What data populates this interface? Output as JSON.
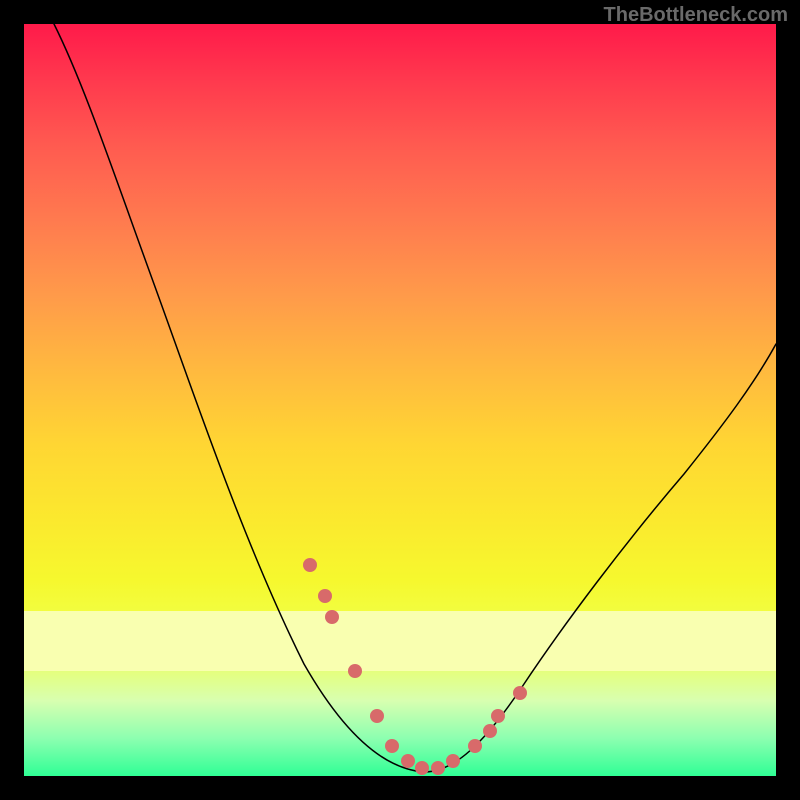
{
  "watermark": "TheBottleneck.com",
  "chart_data": {
    "type": "line",
    "title": "",
    "xlabel": "",
    "ylabel": "",
    "xlim": [
      0,
      100
    ],
    "ylim": [
      0,
      100
    ],
    "grid": false,
    "legend": "none",
    "background": "red-yellow-green vertical gradient (bottleneck heatmap)",
    "series": [
      {
        "name": "bottleneck-curve",
        "x": [
          4,
          10,
          16,
          22,
          28,
          34,
          40,
          44,
          47,
          49,
          51,
          53,
          55,
          57,
          60,
          64,
          70,
          78,
          86,
          94,
          100
        ],
        "y": [
          100,
          88,
          76,
          64,
          51,
          38,
          24,
          14,
          8,
          4,
          2,
          1,
          1,
          2,
          4,
          8,
          16,
          28,
          40,
          50,
          58
        ]
      }
    ],
    "markers": {
      "name": "highlighted-points",
      "x": [
        38,
        40,
        41,
        44,
        47,
        49,
        51,
        53,
        55,
        57,
        60,
        62,
        63,
        66
      ],
      "y": [
        28,
        24,
        21,
        14,
        8,
        4,
        2,
        1,
        1,
        2,
        4,
        6,
        8,
        11
      ]
    },
    "optimum_x": 54
  },
  "colors": {
    "frame": "#000000",
    "watermark": "#6a6a6a",
    "curve": "#000000",
    "marker": "#d86a6a",
    "gradient_top": "#ff1a4a",
    "gradient_mid": "#ffd633",
    "gradient_bottom": "#2fff95"
  }
}
